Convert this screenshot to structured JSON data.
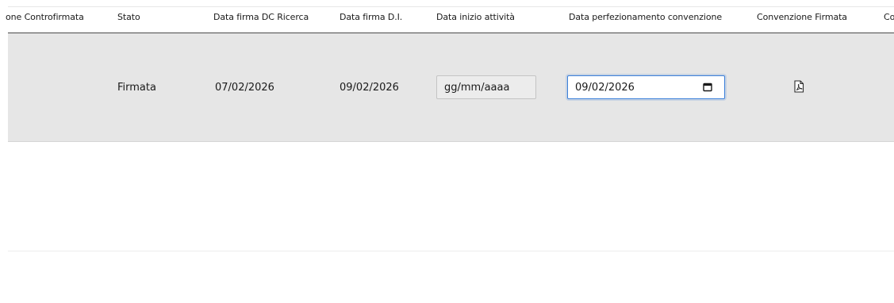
{
  "table": {
    "columns": [
      "one Controfirmata",
      "Stato",
      "Data firma DC Ricerca",
      "Data firma D.I.",
      "Data inizio attività",
      "Data perfezionamento convenzione",
      "Convenzione Firmata",
      "Co"
    ],
    "rows": [
      {
        "stato": "Firmata",
        "data_firma_dc_ricerca": "07/02/2026",
        "data_firma_di": "09/02/2026",
        "data_inizio_attivita_placeholder": "gg/mm/aaaa",
        "data_perfezionamento_convenzione": "09/02/2026",
        "convenzione_firmata_icon": "pdf-file-icon"
      }
    ]
  },
  "colors": {
    "selected_row_background": "#e6e6e6",
    "input_focus_border": "#3b7fd9",
    "header_border": "#4a4a4a"
  }
}
